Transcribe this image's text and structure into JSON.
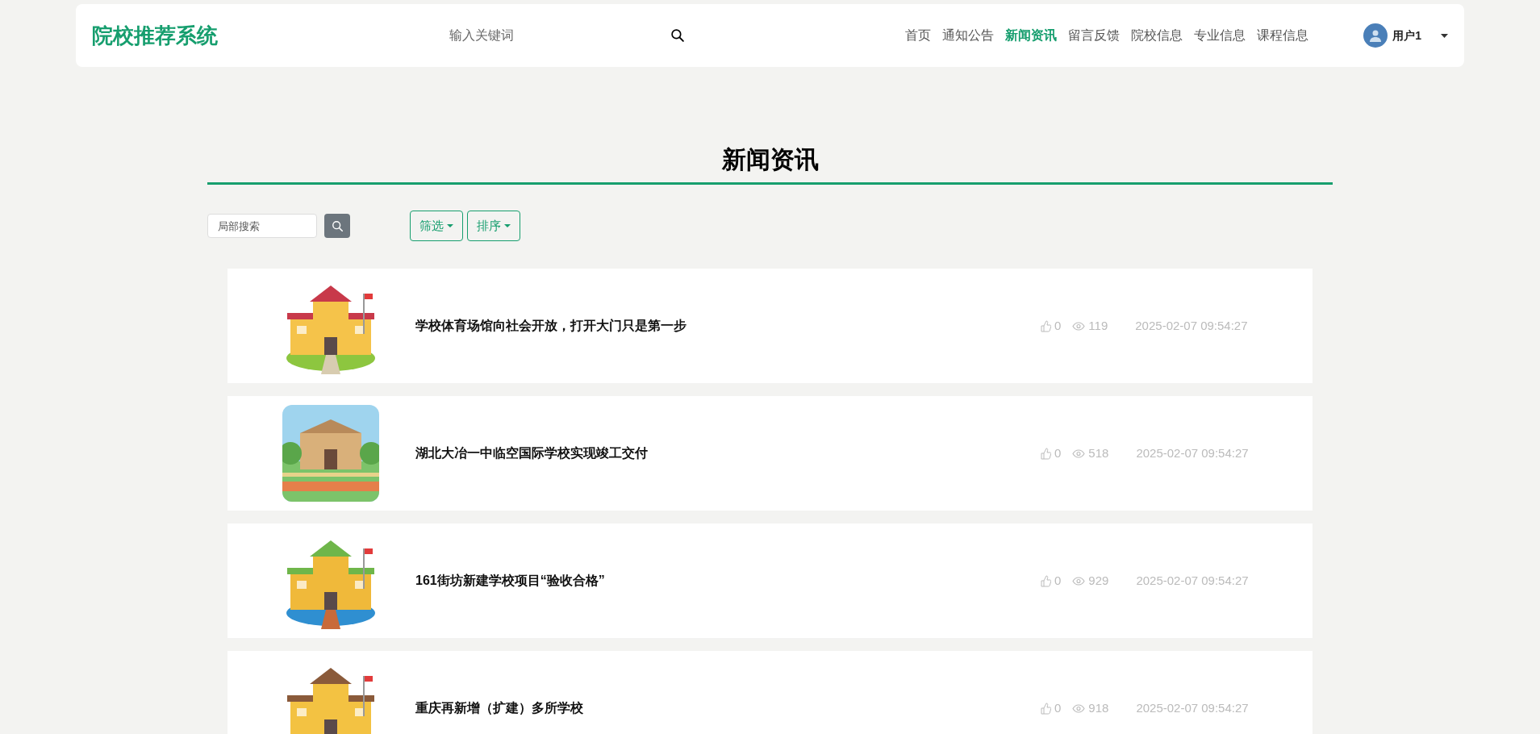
{
  "header": {
    "logo": "院校推荐系统",
    "search": {
      "placeholder": "输入关键词"
    },
    "nav": [
      {
        "label": "首页",
        "selected": false
      },
      {
        "label": "通知公告",
        "selected": false
      },
      {
        "label": "新闻资讯",
        "selected": true
      },
      {
        "label": "留言反馈",
        "selected": false
      },
      {
        "label": "院校信息",
        "selected": false
      },
      {
        "label": "专业信息",
        "selected": false
      },
      {
        "label": "课程信息",
        "selected": false
      }
    ],
    "user": {
      "name": "用户1"
    }
  },
  "page_title": "新闻资讯",
  "toolbar": {
    "search": {
      "placeholder": "局部搜索"
    },
    "buttons": [
      "筛选",
      "排序"
    ]
  },
  "news": [
    {
      "kind": "picture",
      "title": "学校体育场馆向社会开放，打开大门只是第一步",
      "likes": "0",
      "views": "119",
      "date": "2025-02-07 09:54:27"
    },
    {
      "kind": "picture",
      "title": "湖北大冶一中临空国际学校实现竣工交付",
      "likes": "0",
      "views": "518",
      "date": "2025-02-07 09:54:27"
    },
    {
      "kind": "picture",
      "title": "161街坊新建学校项目“验收合格”",
      "likes": "0",
      "views": "929",
      "date": "2025-02-07 09:54:27"
    },
    {
      "kind": "picture",
      "title": "重庆再新增（扩建）多所学校",
      "likes": "0",
      "views": "918",
      "date": "2025-02-07 09:54:27"
    }
  ]
}
